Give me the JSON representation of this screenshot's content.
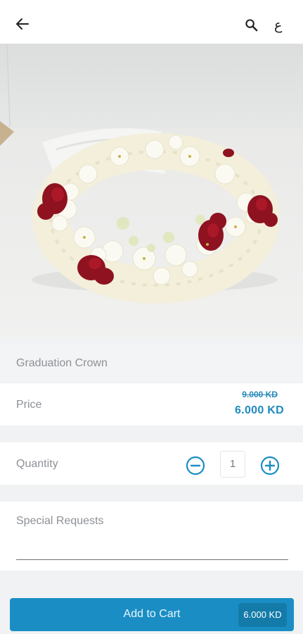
{
  "header": {
    "back_icon": "arrow-left-icon",
    "search_icon": "search-icon",
    "language_toggle": "ع"
  },
  "product": {
    "image_alt": "Graduation Crown",
    "name": "Graduation Crown",
    "price_label": "Price",
    "old_price": "9.000 KD",
    "new_price": "6.000 KD"
  },
  "quantity": {
    "label": "Quantity",
    "value": "1"
  },
  "special_requests": {
    "label": "Special Requests"
  },
  "cart": {
    "button_label": "Add to Cart",
    "total": "6.000 KD"
  },
  "colors": {
    "accent": "#1a8ec4",
    "accent_dark": "#147ba9",
    "flower_red": "#8e1220",
    "flower_white": "#f4f1df"
  }
}
